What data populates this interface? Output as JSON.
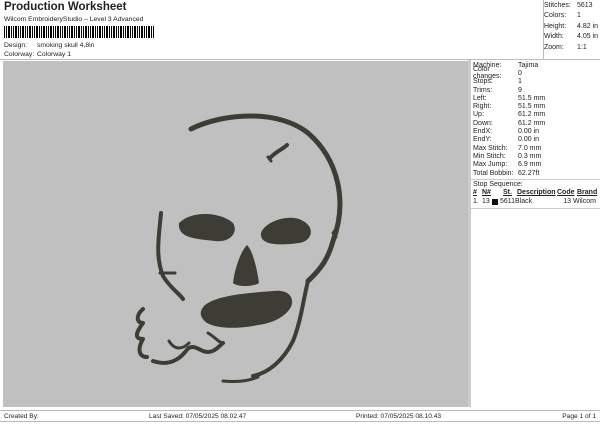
{
  "header": {
    "title": "Production Worksheet",
    "subtitle": "Wilcom EmbroideryStudio – Level 3 Advanced",
    "design_label": "Design:",
    "design_value": "smoking skull 4,8in",
    "colorway_label": "Colorway:",
    "colorway_value": "Colorway 1"
  },
  "summary": [
    {
      "label": "Stitches:",
      "value": "5613"
    },
    {
      "label": "Colors:",
      "value": "1"
    },
    {
      "label": "Height:",
      "value": "4.82 in"
    },
    {
      "label": "Width:",
      "value": "4.05 in"
    },
    {
      "label": "Zoom:",
      "value": "1:1"
    }
  ],
  "details": [
    {
      "label": "Machine:",
      "value": "Tajima"
    },
    {
      "label": "Color changes:",
      "value": "0"
    },
    {
      "label": "Stops:",
      "value": "1"
    },
    {
      "label": "Trims:",
      "value": "9"
    },
    {
      "label": "Left:",
      "value": "51.5 mm"
    },
    {
      "label": "Right:",
      "value": "51.5 mm"
    },
    {
      "label": "Up:",
      "value": "61.2 mm"
    },
    {
      "label": "Down:",
      "value": "61.2 mm"
    },
    {
      "label": "EndX:",
      "value": "0.00 in"
    },
    {
      "label": "EndY:",
      "value": "0.00 in"
    },
    {
      "label": "Max Stitch:",
      "value": "7.0 mm"
    },
    {
      "label": "Min Stitch:",
      "value": "0.3 mm"
    },
    {
      "label": "Max Jump:",
      "value": "6.9 mm"
    },
    {
      "label": "Total Bobbin:",
      "value": "62.27ft"
    }
  ],
  "stop_sequence": {
    "title": "Stop Sequence:",
    "headers": [
      "#",
      "N#",
      "St.",
      "Description",
      "Code",
      "Brand"
    ],
    "rows": [
      {
        "num": "1.",
        "n": "13",
        "st": "5611",
        "description": "Black",
        "code": "13",
        "brand": "Wilcom",
        "color": "#111111"
      }
    ]
  },
  "footer": {
    "created_by": "Created By:",
    "last_saved": "Last Saved: 07/05/2025 08.02.47",
    "printed": "Printed: 07/05/2025 08.10.43",
    "page": "Page 1 of 1"
  },
  "colors": {
    "thread": "#3d3d35",
    "background": "#c0c0c0"
  }
}
